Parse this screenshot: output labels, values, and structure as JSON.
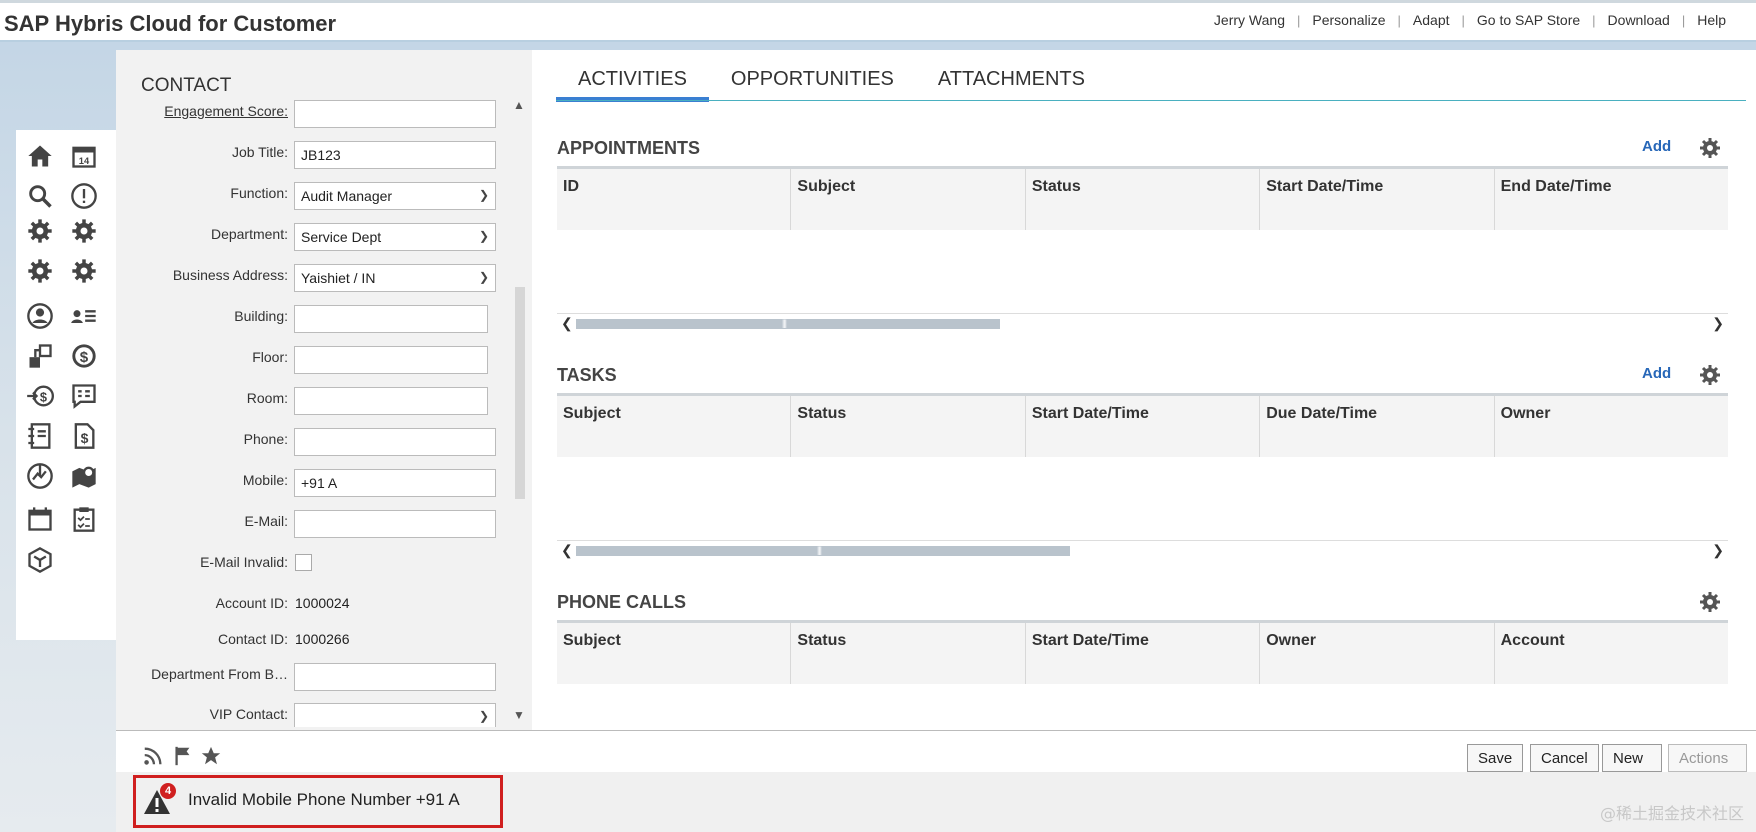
{
  "app": {
    "title": "SAP Hybris Cloud for Customer"
  },
  "top_links": [
    "Jerry Wang",
    "Personalize",
    "Adapt",
    "Go to SAP Store",
    "Download",
    "Help"
  ],
  "nav_icons": [
    "home-icon",
    "calendar-14-icon",
    "search-icon",
    "alert-icon",
    "gear-icon",
    "gear-icon",
    "gear-icon",
    "gear-icon",
    "user-circle-icon",
    "contact-list-icon",
    "org-chart-icon",
    "dollar-circle-icon",
    "money-transfer-icon",
    "chat-dollar-icon",
    "notebook-icon",
    "invoice-dollar-icon",
    "globe-refresh-icon",
    "map-pin-icon",
    "calendar-icon",
    "clipboard-checklist-icon",
    "cube-icon"
  ],
  "contact": {
    "title": "CONTACT",
    "engagement_score_label": "Engagement Score:",
    "engagement_score_value": "",
    "job_title_label": "Job Title:",
    "job_title_value": "JB123",
    "function_label": "Function:",
    "function_value": "Audit Manager",
    "department_label": "Department:",
    "department_value": "Service Dept",
    "business_address_label": "Business Address:",
    "business_address_value": "Yaishiet / IN",
    "building_label": "Building:",
    "building_value": "",
    "floor_label": "Floor:",
    "floor_value": "",
    "room_label": "Room:",
    "room_value": "",
    "phone_label": "Phone:",
    "phone_value": "",
    "mobile_label": "Mobile:",
    "mobile_value": "+91 A",
    "email_label": "E-Mail:",
    "email_value": "",
    "email_invalid_label": "E-Mail Invalid:",
    "account_id_label": "Account ID:",
    "account_id_value": "1000024",
    "contact_id_label": "Contact ID:",
    "contact_id_value": "1000266",
    "dept_from_b_label": "Department From B…",
    "dept_from_b_value": "",
    "vip_contact_label": "VIP Contact:",
    "vip_contact_value": ""
  },
  "tabs": [
    "ACTIVITIES",
    "OPPORTUNITIES",
    "ATTACHMENTS"
  ],
  "appointments": {
    "title": "APPOINTMENTS",
    "add_label": "Add",
    "columns": [
      "ID",
      "Subject",
      "Status",
      "Start Date/Time",
      "End Date/Time"
    ]
  },
  "tasks": {
    "title": "TASKS",
    "add_label": "Add",
    "columns": [
      "Subject",
      "Status",
      "Start Date/Time",
      "Due Date/Time",
      "Owner"
    ]
  },
  "phone_calls": {
    "title": "PHONE CALLS",
    "columns": [
      "Subject",
      "Status",
      "Start Date/Time",
      "Owner",
      "Account"
    ]
  },
  "footer": {
    "save_label": "Save",
    "cancel_label": "Cancel",
    "new_label": "New",
    "actions_label": "Actions"
  },
  "message": {
    "count": "4",
    "text": "Invalid Mobile Phone Number +91 A"
  },
  "watermark": "@稀土掘金技术社区",
  "colors": {
    "accent": "#3a7fd2",
    "link": "#2767b8",
    "error": "#d01f1f"
  }
}
